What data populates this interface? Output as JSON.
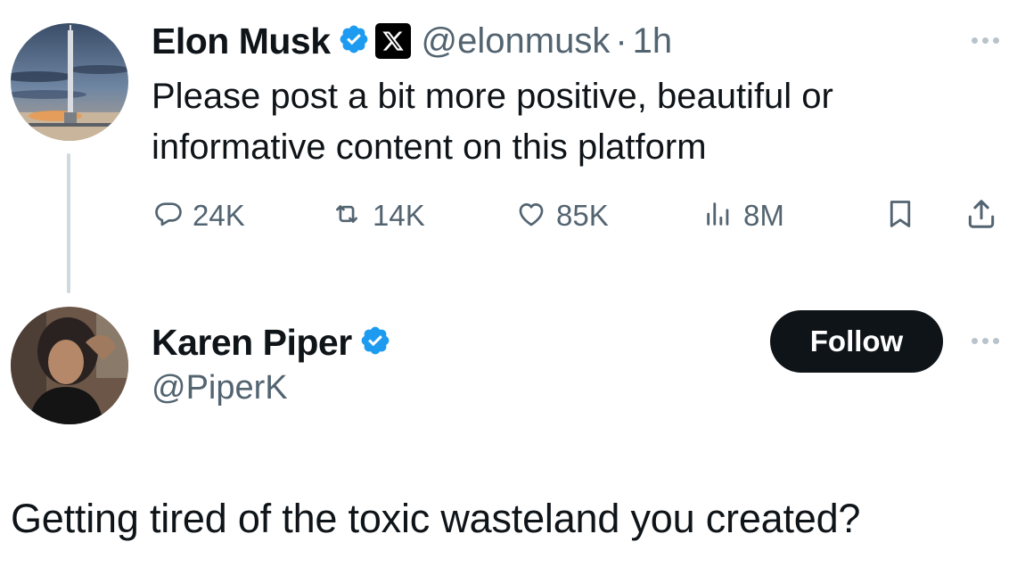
{
  "original_tweet": {
    "author": {
      "name": "Elon Musk",
      "handle": "@elonmusk",
      "verified": true,
      "affiliation_badge": "x-logo-icon"
    },
    "separator": "·",
    "time": "1h",
    "text": "Please post a bit more positive, beautiful or informative content on this platform",
    "stats": {
      "replies": "24K",
      "reposts": "14K",
      "likes": "85K",
      "views": "8M"
    }
  },
  "reply": {
    "author": {
      "name": "Karen Piper",
      "handle": "@PiperK",
      "verified": true
    },
    "follow_label": "Follow",
    "text": "Getting tired of the toxic wasteland you created?"
  },
  "colors": {
    "text_primary": "#0f1419",
    "text_secondary": "#536471",
    "verified_blue": "#1d9bf0",
    "thread_line": "#cfd9de",
    "follow_bg": "#0f1419"
  }
}
